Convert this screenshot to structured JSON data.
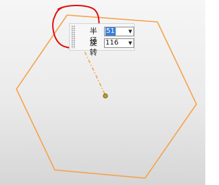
{
  "dynamic_input": {
    "radius": {
      "label": "半径",
      "value": "51"
    },
    "rotation": {
      "label": "旋转",
      "value": "116"
    }
  },
  "icons": {
    "dropdown": "chevron-down-icon",
    "grip": "drag-handle-icon"
  },
  "colors": {
    "shape_stroke": "#f5a24b",
    "center_point": "#b89a2a",
    "annotation": "#e01010",
    "selection": "#3c7fd8"
  }
}
